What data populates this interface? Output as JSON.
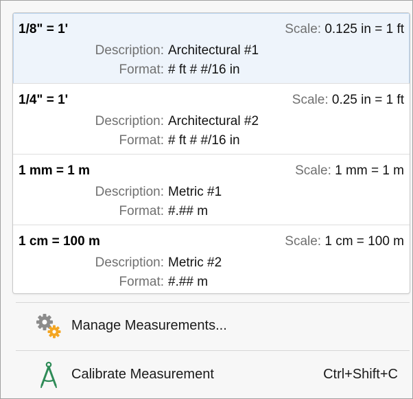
{
  "scales": [
    {
      "name": "1/8\" = 1'",
      "scale_label": "Scale:",
      "scale_value": "0.125 in = 1 ft",
      "description_label": "Description:",
      "description_value": "Architectural #1",
      "format_label": "Format:",
      "format_value": "# ft # #/16 in"
    },
    {
      "name": "1/4\" = 1'",
      "scale_label": "Scale:",
      "scale_value": "0.25 in = 1 ft",
      "description_label": "Description:",
      "description_value": "Architectural #2",
      "format_label": "Format:",
      "format_value": "# ft # #/16 in"
    },
    {
      "name": "1 mm = 1 m",
      "scale_label": "Scale:",
      "scale_value": "1 mm = 1 m",
      "description_label": "Description:",
      "description_value": "Metric #1",
      "format_label": "Format:",
      "format_value": "#.## m"
    },
    {
      "name": "1 cm = 100 m",
      "scale_label": "Scale:",
      "scale_value": "1 cm = 100 m",
      "description_label": "Description:",
      "description_value": "Metric #2",
      "format_label": "Format:",
      "format_value": "#.## m"
    }
  ],
  "commands": {
    "manage": {
      "label": "Manage Measurements...",
      "icon": "gears-icon"
    },
    "calibrate": {
      "label": "Calibrate Measurement",
      "shortcut": "Ctrl+Shift+C",
      "icon": "compass-icon"
    }
  },
  "colors": {
    "gear_gray": "#8c8c8c",
    "gear_orange": "#f4a623",
    "compass_green": "#2e8b57",
    "label_gray": "#707070"
  }
}
